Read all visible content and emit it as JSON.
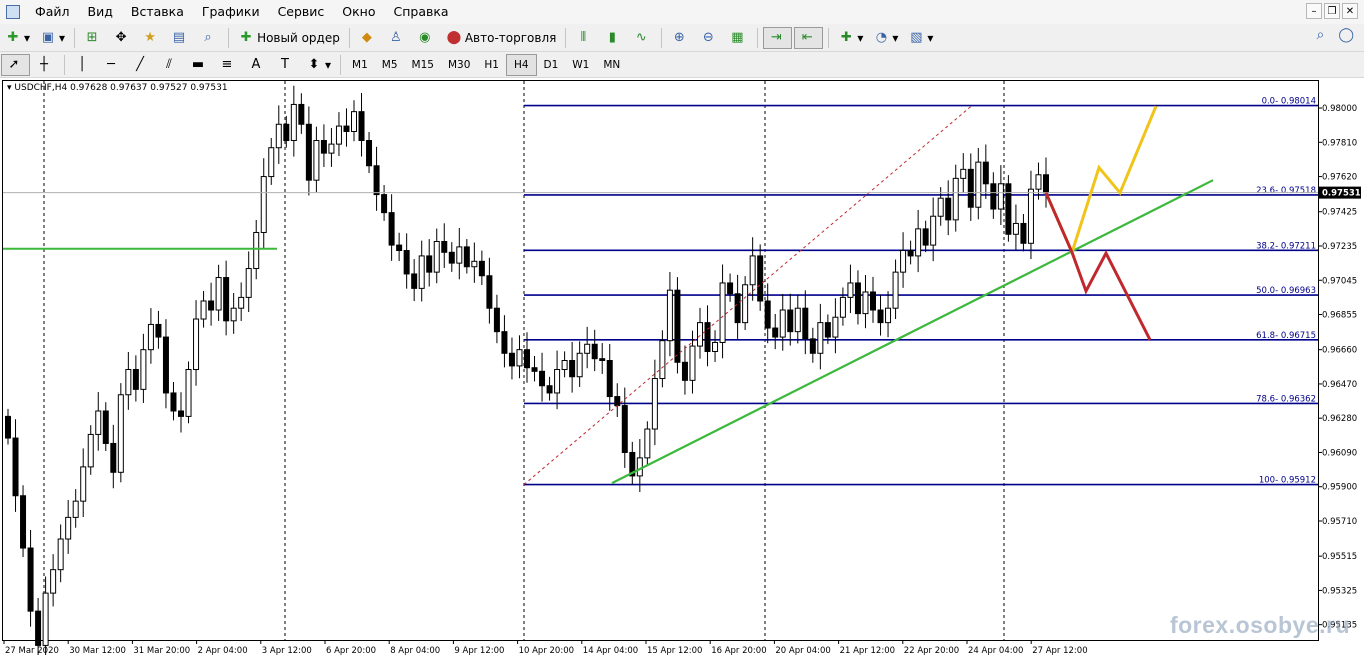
{
  "menu": [
    "Файл",
    "Вид",
    "Вставка",
    "Графики",
    "Сервис",
    "Окно",
    "Справка"
  ],
  "window_buttons": [
    "–",
    "❐",
    "✕"
  ],
  "toolbar1": {
    "new_order": "Новый ордер",
    "auto_trading": "Авто-торговля",
    "icons": [
      "new-chart-icon",
      "profiles-icon",
      "market-watch-icon",
      "navigator-icon",
      "data-window-icon",
      "terminal-icon",
      "tester-icon",
      "new-order-icon",
      "meta-editor-icon",
      "signals-icon",
      "auto-trading-icon",
      "bar-chart-icon",
      "candles-icon",
      "line-chart-icon",
      "zoom-in-icon",
      "zoom-out-icon",
      "tile-icon",
      "autoscroll-icon",
      "chart-shift-icon",
      "indicators-icon",
      "periods-icon",
      "templates-icon",
      "search-icon",
      "chat-icon"
    ]
  },
  "toolbar2": {
    "timeframes": [
      "M1",
      "M5",
      "M15",
      "M30",
      "H1",
      "H4",
      "D1",
      "W1",
      "MN"
    ],
    "active_timeframe": "H4",
    "tools": [
      "cursor-icon",
      "crosshair-icon",
      "vertical-line-icon",
      "horizontal-line-icon",
      "trendline-icon",
      "equidistant-channel-icon",
      "rectangle-icon",
      "fibonacci-icon",
      "text-icon",
      "text-label-icon",
      "arrows-icon"
    ]
  },
  "chart_data": {
    "type": "candlestick",
    "symbol_label": "USDCHF,H4",
    "ohlc_label": "0.97628 0.97637 0.97527 0.97531",
    "ylim": [
      0.9505,
      0.9815
    ],
    "y_ticks": [
      "0.98000",
      "0.97810",
      "0.97620",
      "0.97425",
      "0.97235",
      "0.97045",
      "0.96855",
      "0.96660",
      "0.96470",
      "0.96280",
      "0.96090",
      "0.95900",
      "0.95710",
      "0.95515",
      "0.95325",
      "0.95135"
    ],
    "current_price": "0.97531",
    "x_labels": [
      "27 Mar 2020",
      "30 Mar 12:00",
      "31 Mar 20:00",
      "2 Apr 04:00",
      "3 Apr 12:00",
      "6 Apr 20:00",
      "8 Apr 04:00",
      "9 Apr 12:00",
      "10 Apr 20:00",
      "14 Apr 04:00",
      "15 Apr 12:00",
      "16 Apr 20:00",
      "20 Apr 04:00",
      "21 Apr 12:00",
      "22 Apr 20:00",
      "24 Apr 04:00",
      "27 Apr 12:00"
    ],
    "fibonacci": [
      {
        "label": "0.0- 0.98014",
        "price": 0.98014
      },
      {
        "label": "23.6- 0.97518",
        "price": 0.97518
      },
      {
        "label": "38.2- 0.97211",
        "price": 0.97211
      },
      {
        "label": "50.0- 0.96963",
        "price": 0.96963
      },
      {
        "label": "61.8- 0.96715",
        "price": 0.96715
      },
      {
        "label": "78.6- 0.96362",
        "price": 0.96362
      },
      {
        "label": "100- 0.95912",
        "price": 0.95912
      }
    ],
    "horizontal_level": 0.9722,
    "colors": {
      "fib": "#00008b",
      "trend": "#3cb83c",
      "up_scenario": "#f0c419",
      "down_scenario": "#c0282d",
      "fib_diag": "#c0282d",
      "current": "#000000"
    },
    "closes": [
      0.9617,
      0.9585,
      0.9556,
      0.9521,
      0.9502,
      0.9531,
      0.9544,
      0.9561,
      0.9573,
      0.9582,
      0.9601,
      0.9619,
      0.9632,
      0.9614,
      0.9598,
      0.9641,
      0.9655,
      0.9644,
      0.9666,
      0.968,
      0.9673,
      0.9642,
      0.9632,
      0.9629,
      0.9655,
      0.9683,
      0.9693,
      0.9688,
      0.9706,
      0.9682,
      0.9689,
      0.9695,
      0.9711,
      0.9731,
      0.9762,
      0.9778,
      0.9791,
      0.9782,
      0.9802,
      0.9791,
      0.976,
      0.9782,
      0.9775,
      0.978,
      0.979,
      0.9787,
      0.9798,
      0.9782,
      0.9768,
      0.9752,
      0.9742,
      0.9724,
      0.9721,
      0.9708,
      0.97,
      0.9718,
      0.9709,
      0.9726,
      0.972,
      0.9714,
      0.9723,
      0.9712,
      0.9715,
      0.9707,
      0.9689,
      0.9676,
      0.9664,
      0.9657,
      0.9666,
      0.9656,
      0.9654,
      0.9646,
      0.9642,
      0.9655,
      0.966,
      0.9651,
      0.9664,
      0.9669,
      0.9661,
      0.966,
      0.964,
      0.9635,
      0.9609,
      0.9596,
      0.9606,
      0.9622,
      0.965,
      0.9671,
      0.9699,
      0.9659,
      0.9649,
      0.9668,
      0.9681,
      0.9665,
      0.967,
      0.9703,
      0.9697,
      0.9681,
      0.9702,
      0.9718,
      0.9693,
      0.9678,
      0.9673,
      0.9688,
      0.9676,
      0.9689,
      0.9672,
      0.9664,
      0.9681,
      0.9673,
      0.9684,
      0.9695,
      0.9703,
      0.9686,
      0.9698,
      0.9688,
      0.9681,
      0.9689,
      0.9709,
      0.9721,
      0.9718,
      0.9733,
      0.9724,
      0.974,
      0.975,
      0.9738,
      0.9761,
      0.9766,
      0.9745,
      0.977,
      0.9758,
      0.9744,
      0.9758,
      0.973,
      0.9736,
      0.9725,
      0.9755,
      0.9763,
      0.9753
    ]
  },
  "watermark": "forex.osobye.ru"
}
